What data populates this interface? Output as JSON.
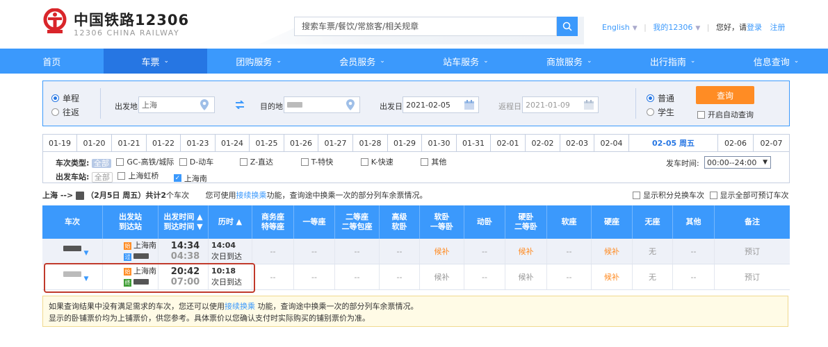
{
  "header": {
    "brand_cn": "中国铁路12306",
    "brand_en": "12306 CHINA RAILWAY",
    "search_placeholder": "搜索车票/餐饮/常旅客/相关规章",
    "lang": "English",
    "my12306": "我的12306",
    "greeting": "您好，请",
    "login": "登录",
    "register": "注册"
  },
  "nav": [
    {
      "label": "首页",
      "chev": ""
    },
    {
      "label": "车票",
      "chev": "⌄"
    },
    {
      "label": "团购服务",
      "chev": "⌄"
    },
    {
      "label": "会员服务",
      "chev": "⌄"
    },
    {
      "label": "站车服务",
      "chev": "⌄"
    },
    {
      "label": "商旅服务",
      "chev": "⌄"
    },
    {
      "label": "出行指南",
      "chev": "⌄"
    },
    {
      "label": "信息查询",
      "chev": "⌄"
    }
  ],
  "form": {
    "trip_oneway": "单程",
    "trip_round": "往返",
    "from_label": "出发地",
    "from_value": "上海",
    "to_label": "目的地",
    "depart_label": "出发日",
    "depart_value": "2021-02-05",
    "return_label": "返程日",
    "return_value": "2021-01-09",
    "ticket_normal": "普通",
    "ticket_student": "学生",
    "query": "查询",
    "auto_query": "开启自动查询"
  },
  "dates": [
    "01-19",
    "01-20",
    "01-21",
    "01-22",
    "01-23",
    "01-24",
    "01-25",
    "01-26",
    "01-27",
    "01-28",
    "01-29",
    "01-30",
    "01-31",
    "02-01",
    "02-02",
    "02-03",
    "02-04",
    "02-05 周五",
    "02-06",
    "02-07"
  ],
  "filter": {
    "type_title": "车次类型:",
    "all": "全部",
    "types": [
      "GC-高铁/城际",
      "D-动车",
      "Z-直达",
      "T-特快",
      "K-快速",
      "其他"
    ],
    "station_title": "出发车站:",
    "stations": [
      "上海虹桥",
      "上海南"
    ],
    "time_label": "发车时间:",
    "time_value": "00:00--24:00"
  },
  "summary": {
    "route": "上海 -->",
    "date": "（2月5日 周五）共计",
    "count": "2",
    "count_suffix": "个车次",
    "tip_pre": "您可使用",
    "tip_link": "接续换乘",
    "tip_post": "功能，查询途中换乘一次的部分列车余票情况。",
    "show_points": "显示积分兑换车次",
    "show_all": "显示全部可预订车次"
  },
  "table": {
    "headers": [
      "车次",
      "出发站\n到达站",
      "出发时间 ▲\n到达时间 ▼",
      "历时 ▲",
      "商务座\n特等座",
      "一等座",
      "二等座\n二等包座",
      "高级\n软卧",
      "软卧\n一等卧",
      "动卧",
      "硬卧\n二等卧",
      "软座",
      "硬座",
      "无座",
      "其他",
      "备注"
    ],
    "rows": [
      {
        "from": "上海南",
        "from_badge": "始",
        "to_badge": "过",
        "depart": "14:34",
        "arrive": "04:38",
        "duration": "14:04",
        "arrive_day": "次日到达",
        "cells": [
          "--",
          "--",
          "--",
          "--",
          "候补",
          "--",
          "候补",
          "--",
          "候补",
          "无",
          "--"
        ],
        "book": "预订"
      },
      {
        "from": "上海南",
        "from_badge": "始",
        "to_badge": "终",
        "depart": "20:42",
        "arrive": "07:00",
        "duration": "10:18",
        "arrive_day": "次日到达",
        "cells": [
          "--",
          "--",
          "--",
          "--",
          "候补",
          "--",
          "候补",
          "--",
          "候补",
          "无",
          "--"
        ],
        "book": "预订"
      }
    ]
  },
  "notice": {
    "line1_pre": "如果查询结果中没有满足需求的车次，您还可以使用",
    "line1_link": "接续换乘",
    "line1_post": " 功能，查询途中换乘一次的部分列车余票情况。",
    "line2": "显示的卧铺票价均为上铺票价，供您参考。具体票价以您确认支付时实际购买的铺别票价为准。"
  },
  "colors": {
    "primary": "#3b99fc",
    "nav_active": "#2676e3",
    "accent": "#ff8c24",
    "highlight": "#c0392b"
  }
}
